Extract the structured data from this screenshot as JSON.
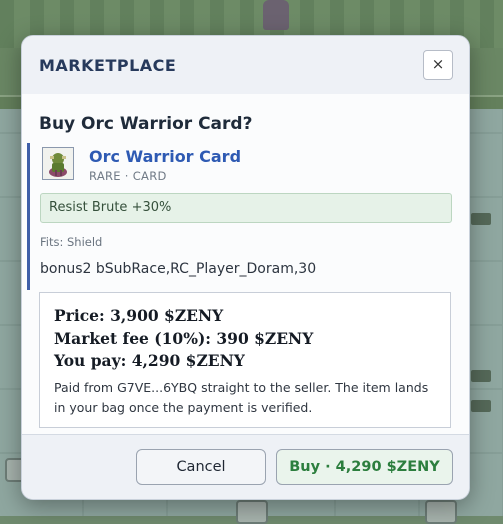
{
  "dialog": {
    "title": "MARKETPLACE",
    "close_label": "×",
    "question": "Buy Orc Warrior Card?"
  },
  "item": {
    "name": "Orc Warrior Card",
    "meta": "RARE · CARD",
    "effect": "Resist Brute +30%",
    "fits": "Fits: Shield",
    "script": "bonus2 bSubRace,RC_Player_Doram,30",
    "icon": "orc-warrior-card-icon"
  },
  "pricing": {
    "price": "Price: 3,900 $ZENY",
    "fee": "Market fee (10%): 390 $ZENY",
    "total": "You pay: 4,290 $ZENY",
    "note": "Paid from G7VE...6YBQ straight to the seller. The item lands in your bag once the payment is verified."
  },
  "footer": {
    "cancel_label": "Cancel",
    "buy_label": "Buy · 4,290 $ZENY"
  },
  "colors": {
    "accent": "#2e5ab3",
    "buy_text": "#2c7e3e",
    "effect_bg": "#e6f2e8"
  }
}
